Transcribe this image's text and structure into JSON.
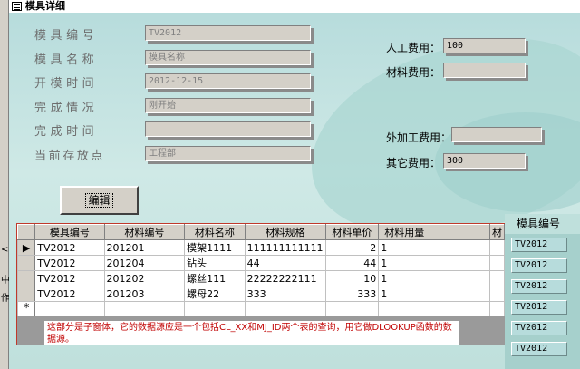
{
  "window": {
    "title": "模具详细"
  },
  "edge_glyphs": [
    "<",
    "中",
    "作"
  ],
  "fields_left": [
    {
      "label": "模具编号",
      "value": "TV2012"
    },
    {
      "label": "模具名称",
      "value": "模具名称"
    },
    {
      "label": "开模时间",
      "value": "2012-12-15"
    },
    {
      "label": "完成情况",
      "value": "刚开始"
    },
    {
      "label": "完成时间",
      "value": ""
    },
    {
      "label": "当前存放点",
      "value": "工程部"
    }
  ],
  "fields_right": [
    {
      "label": "人工费用：",
      "value": "100"
    },
    {
      "label": "材料费用：",
      "value": ""
    },
    {
      "label": "外加工费用：",
      "value": ""
    },
    {
      "label": "其它费用：",
      "value": "300"
    }
  ],
  "edit_button": {
    "label": "编辑"
  },
  "subform": {
    "columns": [
      "模具编号",
      "材料编号",
      "材料名称",
      "材料规格",
      "材料单价",
      "材料用量",
      "",
      "材"
    ],
    "rows": [
      [
        "TV2012",
        "201201",
        "模架1111",
        "111111111111",
        "2",
        "1"
      ],
      [
        "TV2012",
        "201204",
        "钻头",
        "44",
        "44",
        "1"
      ],
      [
        "TV2012",
        "201202",
        "螺丝111",
        "22222222111",
        "10",
        "1"
      ],
      [
        "TV2012",
        "201203",
        "螺母22",
        "333",
        "333",
        "1"
      ]
    ],
    "new_row_marker": "*",
    "current_row_marker": "▶",
    "note": "这部分是子窗体，它的数据源应是一个包括CL_XX和MJ_ID两个表的查询，用它做DLOOKUP函数的数据源。"
  },
  "right_panel": {
    "header": "模具编号",
    "values": [
      "TV2012",
      "TV2012",
      "TV2012",
      "TV2012",
      "TV2012",
      "TV2012"
    ]
  }
}
